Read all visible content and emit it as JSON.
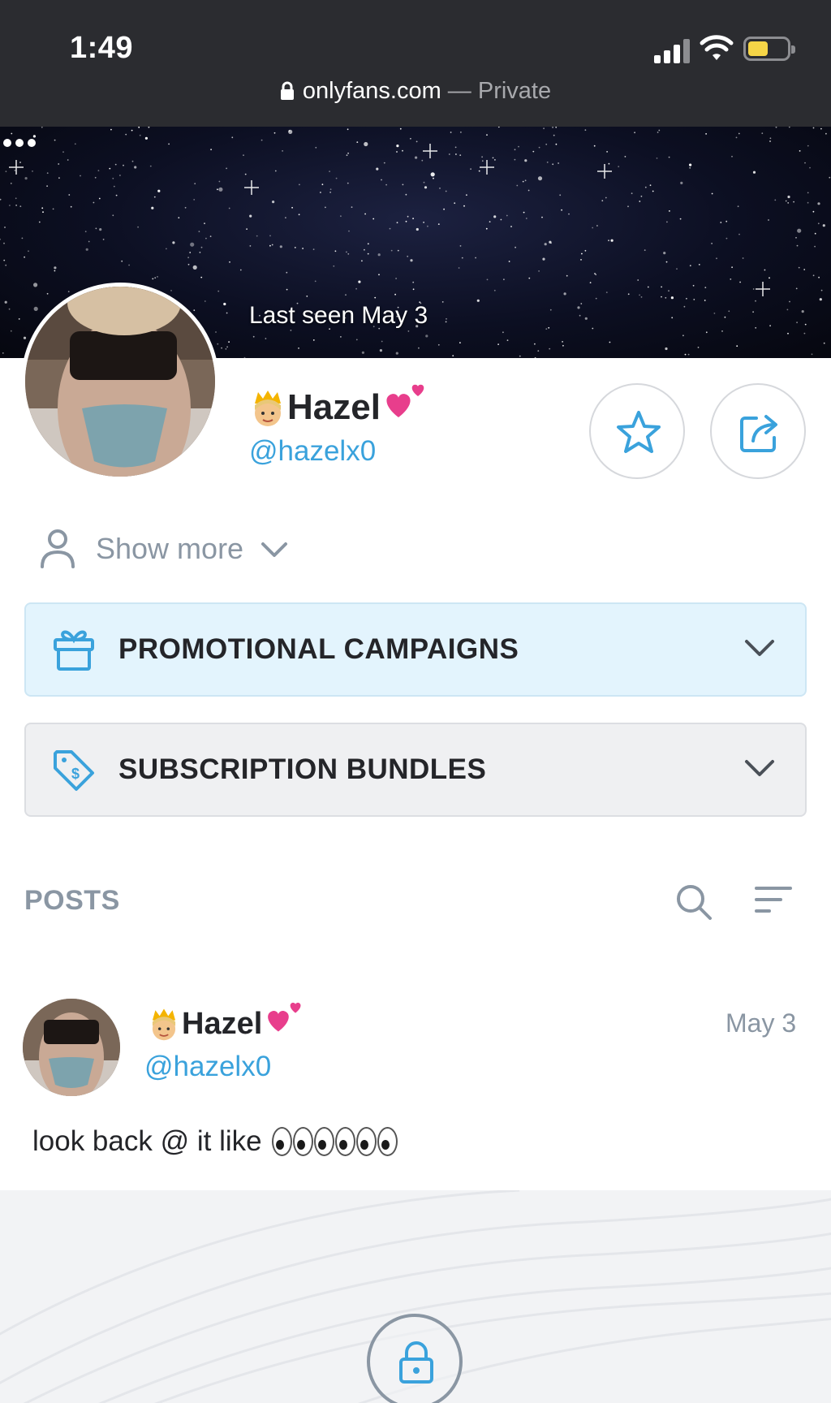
{
  "status_bar": {
    "time": "1:49",
    "url_domain": "onlyfans.com",
    "url_suffix": " — Private",
    "battery_level": 0.4,
    "battery_color": "#f5d547"
  },
  "profile": {
    "last_seen": "Last seen May 3",
    "name": "Hazel",
    "name_prefix_emoji": "princess-emoji",
    "name_suffix_emoji": "two-hearts-emoji",
    "handle": "@hazelx0",
    "more_icon": "more-dots-icon",
    "favorite_icon": "star-icon",
    "share_icon": "share-icon"
  },
  "show_more": {
    "label": "Show more",
    "icon": "user-icon"
  },
  "accordions": {
    "promotional": {
      "label": "PROMOTIONAL CAMPAIGNS",
      "icon": "gift-icon"
    },
    "bundles": {
      "label": "SUBSCRIPTION BUNDLES",
      "icon": "price-tag-icon"
    }
  },
  "posts": {
    "title": "POSTS",
    "search_icon": "search-icon",
    "sort_icon": "sort-icon"
  },
  "post": {
    "name": "Hazel",
    "handle": "@hazelx0",
    "date": "May 3",
    "text": "look back @ it like",
    "emoji": "eyes-emoji ×3",
    "locked_icon": "lock-icon"
  },
  "colors": {
    "accent": "#3aa2dc",
    "muted": "#8a96a3",
    "status_bar_bg": "#2b2c30",
    "promo_bg": "#e3f4fd",
    "bundles_bg": "#eff0f2"
  }
}
